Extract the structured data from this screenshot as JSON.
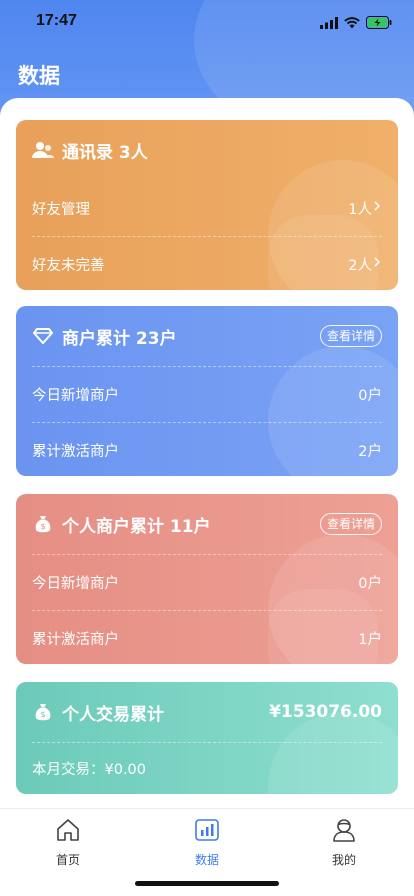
{
  "status_bar": {
    "time": "17:47"
  },
  "header": {
    "title": "数据"
  },
  "cards": {
    "contacts": {
      "title": "通讯录 3人",
      "icon": "users-icon",
      "rows": [
        {
          "label": "好友管理",
          "value": "1人"
        },
        {
          "label": "好友未完善",
          "value": "2人"
        }
      ]
    },
    "merchants": {
      "title": "商户累计 23户",
      "icon": "diamond-icon",
      "detail_label": "查看详情",
      "rows": [
        {
          "label": "今日新增商户",
          "value": "0户"
        },
        {
          "label": "累计激活商户",
          "value": "2户"
        }
      ]
    },
    "personal_merchants": {
      "title": "个人商户累计 11户",
      "icon": "money-bag-icon",
      "detail_label": "查看详情",
      "rows": [
        {
          "label": "今日新增商户",
          "value": "0户"
        },
        {
          "label": "累计激活商户",
          "value": "1户"
        }
      ]
    },
    "transactions": {
      "title": "个人交易累计",
      "icon": "money-bag-icon",
      "total": "¥153076.00",
      "month_label": "本月交易：¥0.00"
    }
  },
  "tabbar": {
    "items": [
      {
        "label": "首页",
        "icon": "home-icon"
      },
      {
        "label": "数据",
        "icon": "chart-icon"
      },
      {
        "label": "我的",
        "icon": "profile-icon"
      }
    ],
    "active_index": 1
  },
  "colors": {
    "header_blue": "#4f86f0",
    "card_orange": "#e8a05a",
    "card_blue": "#6a94f0",
    "card_red": "#e58e84",
    "card_teal": "#6ccab9",
    "tab_active": "#3e7bf0"
  }
}
